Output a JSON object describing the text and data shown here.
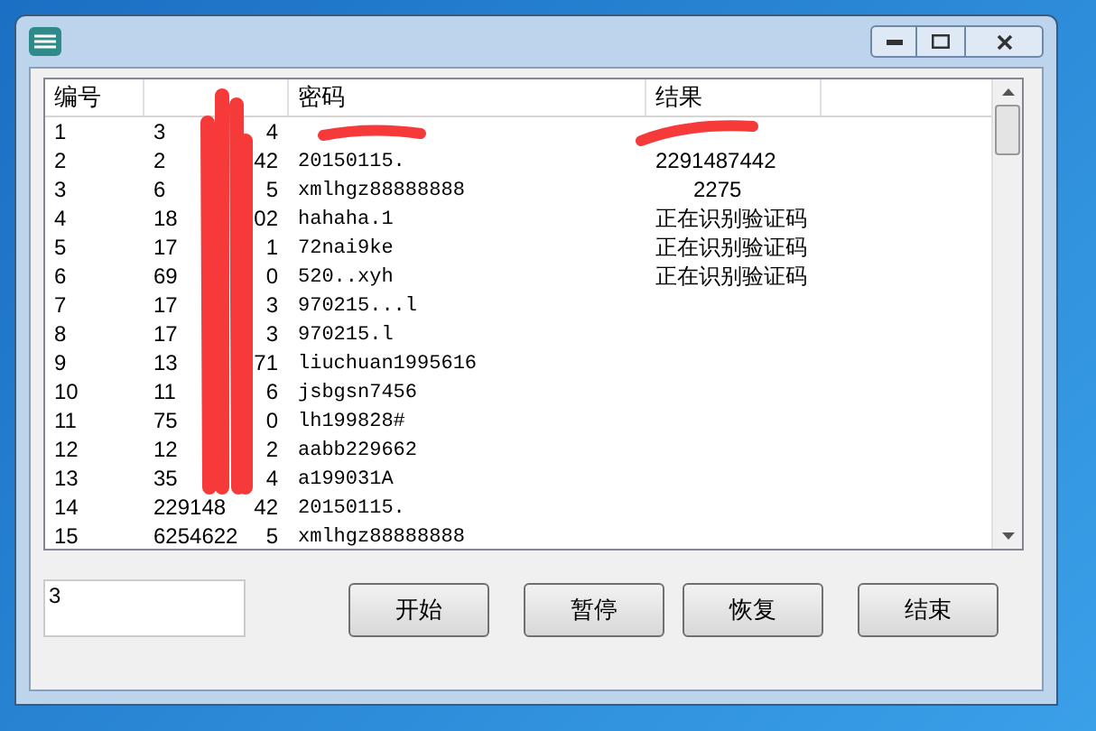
{
  "table": {
    "columns": [
      "编号",
      "",
      "",
      "密码",
      "结果"
    ],
    "rows": [
      {
        "cells": [
          "1",
          "3",
          "4",
          "",
          ""
        ]
      },
      {
        "cells": [
          "2",
          "2",
          "42",
          "20150115.",
          "2291487442"
        ]
      },
      {
        "cells": [
          "3",
          "6",
          "5",
          "xmlhgz88888888",
          "2275"
        ]
      },
      {
        "cells": [
          "4",
          "18",
          "02",
          "hahaha.1",
          "正在识别验证码"
        ]
      },
      {
        "cells": [
          "5",
          "17",
          "1",
          "72nai9ke",
          "正在识别验证码"
        ]
      },
      {
        "cells": [
          "6",
          "69",
          "0",
          "520..xyh",
          "正在识别验证码"
        ]
      },
      {
        "cells": [
          "7",
          "17",
          "3",
          "970215...l",
          ""
        ]
      },
      {
        "cells": [
          "8",
          "17",
          "3",
          "970215.l",
          ""
        ]
      },
      {
        "cells": [
          "9",
          "13",
          "71",
          "liuchuan1995616",
          ""
        ]
      },
      {
        "cells": [
          "10",
          "11",
          "6",
          "jsbgsn7456",
          ""
        ]
      },
      {
        "cells": [
          "11",
          "75",
          "0",
          "lh199828#",
          ""
        ]
      },
      {
        "cells": [
          "12",
          "12",
          "2",
          "aabb229662",
          ""
        ]
      },
      {
        "cells": [
          "13",
          "35",
          "4",
          "a199031A",
          ""
        ]
      },
      {
        "cells": [
          "14",
          "229148",
          "42",
          "20150115.",
          ""
        ]
      },
      {
        "cells": [
          "15",
          "6254622",
          "5",
          "xmlhgz88888888",
          ""
        ]
      }
    ]
  },
  "count_field": {
    "value": "3"
  },
  "buttons": [
    "开始",
    "暂停",
    "恢复",
    "结束"
  ]
}
